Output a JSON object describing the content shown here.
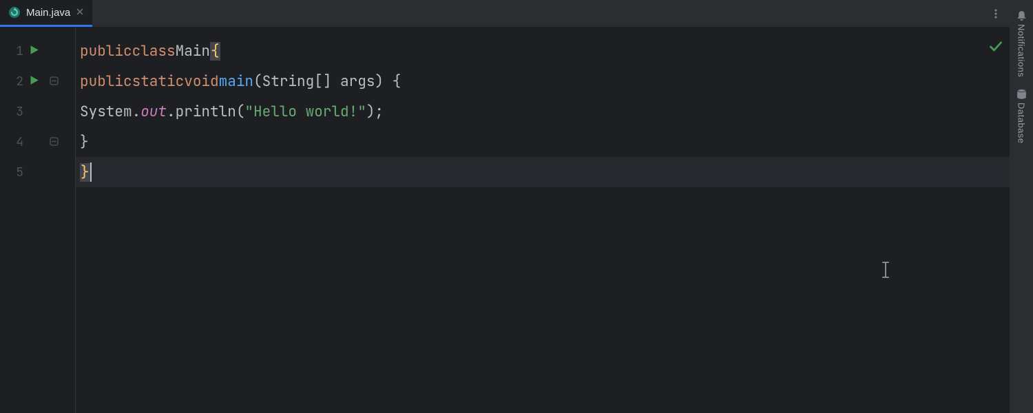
{
  "tab": {
    "filename": "Main.java"
  },
  "gutter": {
    "lines": [
      "1",
      "2",
      "3",
      "4",
      "5"
    ]
  },
  "code": {
    "line1": {
      "kw1": "public",
      "kw2": "class",
      "name": "Main",
      "brace": "{"
    },
    "line2": {
      "kw1": "public",
      "kw2": "static",
      "kw3": "void",
      "fn": "main",
      "sig": "(String[] args) {"
    },
    "line3": {
      "pre": "System.",
      "field": "out",
      "post": ".println(",
      "str": "\"Hello world!\"",
      "end": ");"
    },
    "line4": {
      "brace": "}"
    },
    "line5": {
      "brace": "}"
    }
  },
  "right_stripe": {
    "notifications_label": "Notifications",
    "database_label": "Database"
  }
}
